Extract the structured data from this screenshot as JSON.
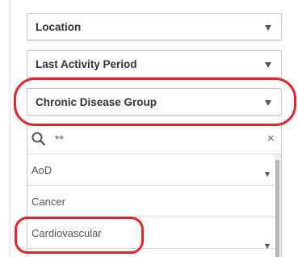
{
  "filters": {
    "location": {
      "label": "Location"
    },
    "last_activity": {
      "label": "Last Activity Period"
    },
    "chronic_disease": {
      "label": "Chronic Disease Group"
    }
  },
  "search": {
    "value": "**"
  },
  "list": {
    "items": [
      {
        "label": "AoD"
      },
      {
        "label": "Cancer"
      },
      {
        "label": "Cardiovascular"
      }
    ]
  },
  "icons": {
    "search": "search-icon",
    "clear": "close-icon",
    "dropdown": "chevron-down-icon"
  },
  "colors": {
    "annotation": "#e3242b",
    "border": "#c8c8c8",
    "text": "#333333"
  }
}
